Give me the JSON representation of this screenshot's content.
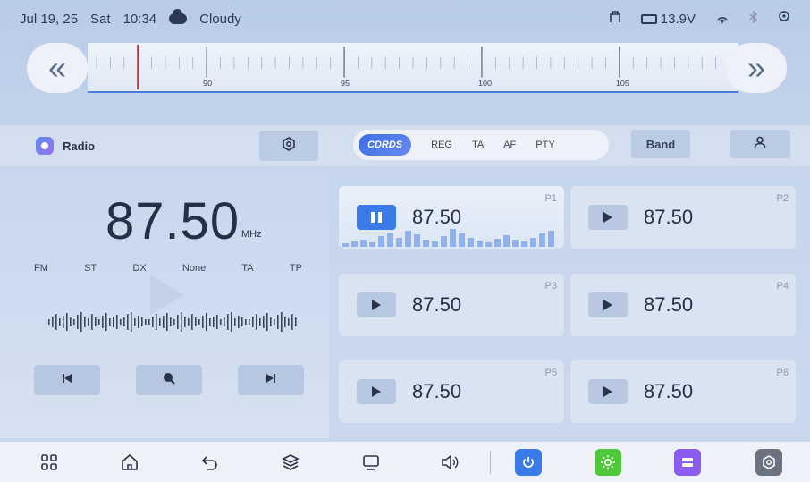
{
  "status": {
    "date": "Jul 19, 25",
    "day": "Sat",
    "time": "10:34",
    "weather": "Cloudy",
    "voltage": "13.9V",
    "icons": [
      "usb-icon",
      "battery-icon",
      "hotspot-icon",
      "bluetooth-icon",
      "location-icon"
    ]
  },
  "tuner": {
    "scale_labels": [
      "90",
      "95",
      "100",
      "105"
    ],
    "current_position_mhz": 87.5,
    "range_mhz": [
      86,
      109
    ]
  },
  "radio": {
    "title": "Radio",
    "frequency": "87.50",
    "unit": "MHz",
    "flags": [
      "FM",
      "ST",
      "DX",
      "None",
      "TA",
      "TP"
    ]
  },
  "rds": {
    "tag": "CDRDS",
    "options": [
      "REG",
      "TA",
      "AF",
      "PTY"
    ],
    "band_label": "Band"
  },
  "presets": [
    {
      "label": "P1",
      "freq": "87.50",
      "state": "playing"
    },
    {
      "label": "P2",
      "freq": "87.50",
      "state": "stopped"
    },
    {
      "label": "P3",
      "freq": "87.50",
      "state": "stopped"
    },
    {
      "label": "P4",
      "freq": "87.50",
      "state": "stopped"
    },
    {
      "label": "P5",
      "freq": "87.50",
      "state": "stopped"
    },
    {
      "label": "P6",
      "freq": "87.50",
      "state": "stopped"
    }
  ],
  "dock": {
    "items": [
      "apps-icon",
      "home-icon",
      "back-icon",
      "layers-icon",
      "screen-icon",
      "volume-icon",
      "power-icon",
      "brightness-icon",
      "storage-icon",
      "settings-icon"
    ],
    "colors": {
      "power": "#3b7be8",
      "brightness": "#4fc73a",
      "storage": "#8a5cf0",
      "settings": "#6b7280"
    }
  }
}
